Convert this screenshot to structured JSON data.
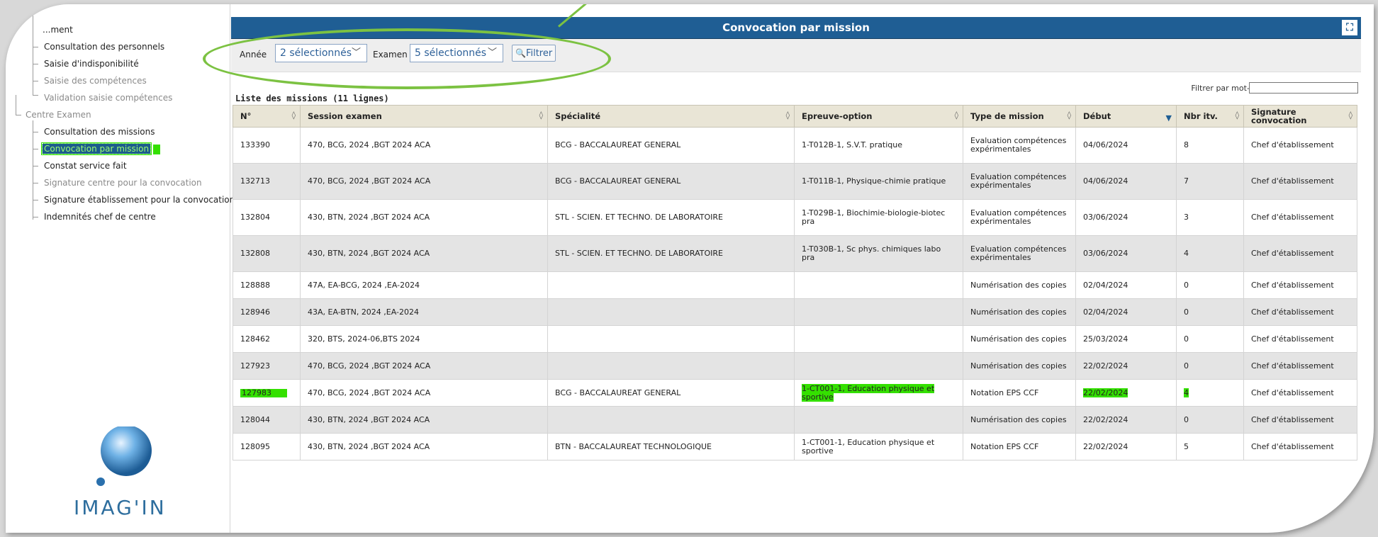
{
  "sidebar": {
    "items": [
      {
        "label": "...ment",
        "grey": false
      },
      {
        "label": "Consultation des personnels",
        "grey": false
      },
      {
        "label": "Saisie d'indisponibilité",
        "grey": false
      },
      {
        "label": "Saisie des compétences",
        "grey": true
      },
      {
        "label": "Validation saisie compétences",
        "grey": true
      },
      {
        "label": "Centre Examen",
        "grey": true
      },
      {
        "label": "Consultation des missions",
        "grey": false
      },
      {
        "label": "Convocation par mission",
        "grey": false
      },
      {
        "label": "Constat service fait",
        "grey": false
      },
      {
        "label": "Signature centre pour la convocation",
        "grey": true
      },
      {
        "label": "Signature établissement pour la convocation",
        "grey": false
      },
      {
        "label": "Indemnités chef de centre",
        "grey": false
      }
    ],
    "logo_text": "IMAG'IN"
  },
  "header": {
    "title": "Convocation par mission"
  },
  "filters": {
    "annee_label": "Année",
    "annee_value": "2 sélectionnés",
    "examen_label": "Examen",
    "examen_value": "5 sélectionnés",
    "filter_button": "Filtrer"
  },
  "list": {
    "title": "Liste des missions (11 lignes)",
    "keyword_label": "Filtrer par mot-clé :",
    "columns": [
      "N°",
      "Session examen",
      "Spécialité",
      "Epreuve-option",
      "Type de mission",
      "Début",
      "Nbr itv.",
      "Signature convocation"
    ],
    "rows": [
      [
        "133390",
        "470, BCG, 2024 ,BGT 2024 ACA",
        "BCG - BACCALAUREAT GENERAL",
        "1-T012B-1, S.V.T. pratique",
        "Evaluation compétences expérimentales",
        "04/06/2024",
        "8",
        "Chef d'établissement"
      ],
      [
        "132713",
        "470, BCG, 2024 ,BGT 2024 ACA",
        "BCG - BACCALAUREAT GENERAL",
        "1-T011B-1, Physique-chimie pratique",
        "Evaluation compétences expérimentales",
        "04/06/2024",
        "7",
        "Chef d'établissement"
      ],
      [
        "132804",
        "430, BTN, 2024 ,BGT 2024 ACA",
        "STL - SCIEN. ET TECHNO. DE LABORATOIRE",
        "1-T029B-1, Biochimie-biologie-biotec pra",
        "Evaluation compétences expérimentales",
        "03/06/2024",
        "3",
        "Chef d'établissement"
      ],
      [
        "132808",
        "430, BTN, 2024 ,BGT 2024 ACA",
        "STL - SCIEN. ET TECHNO. DE LABORATOIRE",
        "1-T030B-1, Sc phys. chimiques labo pra",
        "Evaluation compétences expérimentales",
        "03/06/2024",
        "4",
        "Chef d'établissement"
      ],
      [
        "128888",
        "47A, EA-BCG, 2024 ,EA-2024",
        "",
        "",
        "Numérisation des copies",
        "02/04/2024",
        "0",
        "Chef d'établissement"
      ],
      [
        "128946",
        "43A, EA-BTN, 2024 ,EA-2024",
        "",
        "",
        "Numérisation des copies",
        "02/04/2024",
        "0",
        "Chef d'établissement"
      ],
      [
        "128462",
        "320, BTS, 2024-06,BTS 2024",
        "",
        "",
        "Numérisation des copies",
        "25/03/2024",
        "0",
        "Chef d'établissement"
      ],
      [
        "127923",
        "470, BCG, 2024 ,BGT 2024 ACA",
        "",
        "",
        "Numérisation des copies",
        "22/02/2024",
        "0",
        "Chef d'établissement"
      ],
      [
        "127983",
        "470, BCG, 2024 ,BGT 2024 ACA",
        "BCG - BACCALAUREAT GENERAL",
        "1-CT001-1, Education physique et sportive",
        "Notation EPS CCF",
        "22/02/2024",
        "4",
        "Chef d'établissement"
      ],
      [
        "128044",
        "430, BTN, 2024 ,BGT 2024 ACA",
        "",
        "",
        "Numérisation des copies",
        "22/02/2024",
        "0",
        "Chef d'établissement"
      ],
      [
        "128095",
        "430, BTN, 2024 ,BGT 2024 ACA",
        "BTN - BACCALAUREAT TECHNOLOGIQUE",
        "1-CT001-1, Education physique et sportive",
        "Notation EPS CCF",
        "22/02/2024",
        "5",
        "Chef d'établissement"
      ]
    ]
  },
  "colors": {
    "accent": "#1f5e94",
    "highlight": "#34e000",
    "annotation": "#7cc242"
  }
}
